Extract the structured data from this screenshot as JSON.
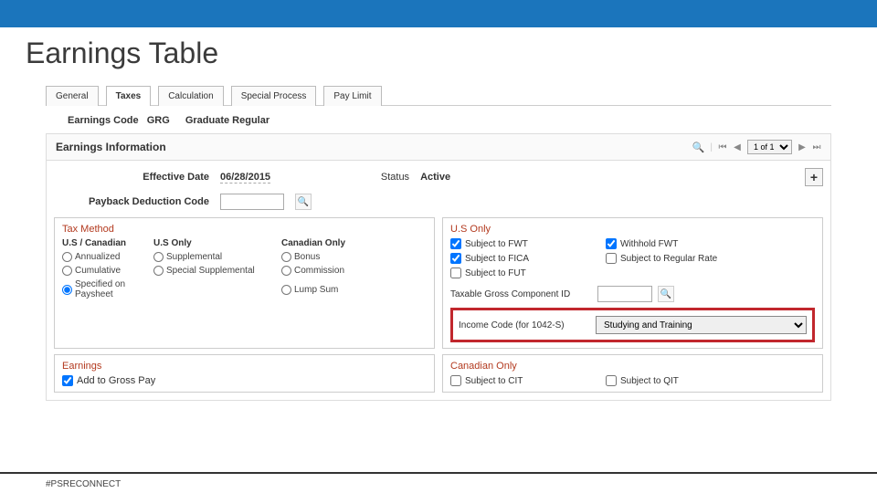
{
  "slide": {
    "title": "Earnings Table",
    "footer_tag": "#PSRECONNECT"
  },
  "tabs": [
    "General",
    "Taxes",
    "Calculation",
    "Special Process",
    "Pay Limit"
  ],
  "active_tab_index": 1,
  "subhead": {
    "label": "Earnings Code",
    "code": "GRG",
    "desc": "Graduate Regular"
  },
  "section": {
    "title": "Earnings Information",
    "pager_text": "1 of 1"
  },
  "effective": {
    "label": "Effective Date",
    "value": "06/28/2015",
    "status_label": "Status",
    "status_value": "Active"
  },
  "payback": {
    "label": "Payback Deduction Code",
    "value": ""
  },
  "tax_method": {
    "title": "Tax Method",
    "headers": [
      "U.S / Canadian",
      "U.S Only",
      "Canadian Only"
    ],
    "rows": [
      [
        "Annualized",
        "Supplemental",
        "Bonus"
      ],
      [
        "Cumulative",
        "Special Supplemental",
        "Commission"
      ],
      [
        "Specified on Paysheet",
        "",
        "Lump Sum"
      ]
    ],
    "selected": "Specified on Paysheet"
  },
  "us_only": {
    "title": "U.S Only",
    "items": [
      {
        "label": "Subject to FWT",
        "checked": true
      },
      {
        "label": "Withhold FWT",
        "checked": true
      },
      {
        "label": "Subject to FICA",
        "checked": true
      },
      {
        "label": "Subject to Regular Rate",
        "checked": false
      },
      {
        "label": "Subject to FUT",
        "checked": false
      }
    ],
    "taxable_gross_label": "Taxable Gross Component ID",
    "taxable_gross_value": "",
    "income_code_label": "Income Code (for 1042-S)",
    "income_code_value": "Studying and Training"
  },
  "earnings": {
    "title": "Earnings",
    "add_to_gross": {
      "label": "Add to Gross Pay",
      "checked": true
    }
  },
  "canadian_only": {
    "title": "Canadian Only",
    "items": [
      {
        "label": "Subject to CIT",
        "checked": false
      },
      {
        "label": "Subject to QIT",
        "checked": false
      }
    ]
  }
}
